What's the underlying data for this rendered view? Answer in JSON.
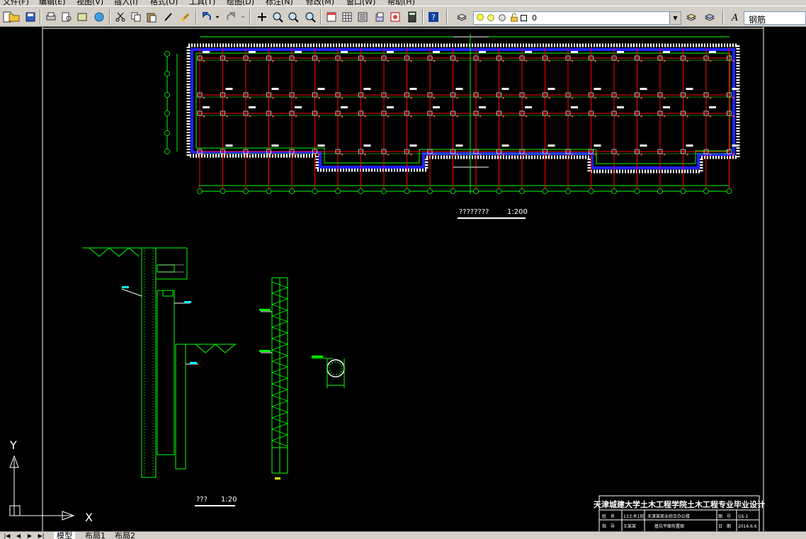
{
  "menu": {
    "items": [
      "文件(F)",
      "编辑(E)",
      "视图(V)",
      "插入(I)",
      "格式(O)",
      "工具(T)",
      "绘图(D)",
      "标注(N)",
      "修改(M)",
      "窗口(W)",
      "帮助(H)"
    ]
  },
  "toolbar": {
    "layer_value": "0",
    "text_style_value": "钢筋"
  },
  "drawing": {
    "plan_title": "????????",
    "plan_scale": "1:200",
    "section_title": "???",
    "section_scale": "1:20",
    "ucs_x": "X",
    "ucs_y": "Y",
    "title_block": {
      "school": "天津城建大学土木工程学院土木工程专业毕业设计",
      "row1_c1": "姓　名",
      "row1_c2": "13土木1班",
      "row1_c3": "天津某商业综合办公楼",
      "row1_c4": "图　号",
      "row1_c5": "GS-1",
      "row2_c1": "指　导",
      "row2_c2": "王某某",
      "row2_c3": "基坑平面布置图",
      "row2_c4": "日　期",
      "row2_c5": "2016.6.6"
    }
  },
  "tabs": {
    "model": "模型",
    "layout1": "布局1",
    "layout2": "布局2"
  },
  "colors": {
    "ui_gray": "#d4d0c8",
    "canvas": "#000000",
    "cad_green": "#00ff00",
    "cad_red": "#ff0000",
    "cad_blue": "#0000ff",
    "cad_white": "#ffffff"
  }
}
